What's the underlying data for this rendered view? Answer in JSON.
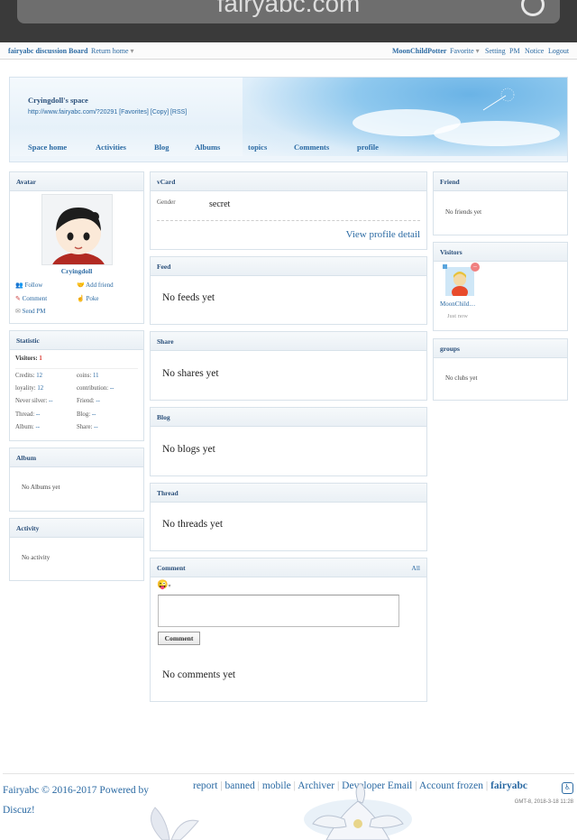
{
  "browser": {
    "url": "fairyabc.com"
  },
  "toolbar": {
    "site": "fairyabc discussion Board",
    "return_home": "Return home",
    "user": "MoonChildPotter",
    "favorite": "Favorite",
    "setting": "Setting",
    "pm": "PM",
    "notice": "Notice",
    "logout": "Logout"
  },
  "hero": {
    "title": "Cryingdoll's space",
    "url_line": "http://www.fairyabc.com/?20291 [Favorites] [Copy] [RSS]",
    "tabs": [
      "Space home",
      "Activities",
      "Blog",
      "Albums",
      "topics",
      "Comments",
      "profile"
    ]
  },
  "avatar": {
    "header": "Avatar",
    "name": "Cryingdoll",
    "actions": [
      "Follow",
      "Add friend",
      "Comment",
      "Poke",
      "Send PM"
    ]
  },
  "statistic": {
    "header": "Statistic",
    "visitors_label": "Visitors:",
    "visitors": "1",
    "rows": [
      [
        "Credits:",
        "12",
        "coins:",
        "11"
      ],
      [
        "loyality:",
        "12",
        "contribution:",
        "--"
      ],
      [
        "Never silver:",
        "--",
        "Friend:",
        "--"
      ],
      [
        "Thread:",
        "--",
        "Blog:",
        "--"
      ],
      [
        "Album:",
        "--",
        "Share:",
        "--"
      ]
    ]
  },
  "album": {
    "header": "Album",
    "empty": "No Albums yet"
  },
  "activity": {
    "header": "Activity",
    "empty": "No activity"
  },
  "vcard": {
    "header": "vCard",
    "gender_label": "Gender",
    "gender_value": "secret",
    "detail_link": "View profile detail"
  },
  "feed": {
    "header": "Feed",
    "empty": "No feeds yet"
  },
  "share": {
    "header": "Share",
    "empty": "No shares yet"
  },
  "blog": {
    "header": "Blog",
    "empty": "No blogs yet"
  },
  "thread": {
    "header": "Thread",
    "empty": "No threads yet"
  },
  "comment": {
    "header": "Comment",
    "all": "All",
    "button": "Comment",
    "empty": "No comments yet"
  },
  "friend": {
    "header": "Friend",
    "empty": "No friends yet"
  },
  "visitors": {
    "header": "Visitors",
    "name": "MoonChild…",
    "time": "Just now"
  },
  "groups": {
    "header": "groups",
    "empty": "No clubs yet"
  },
  "footer": {
    "copyright": "Fairyabc © 2016-2017 Powered by",
    "powered": "Discuz!",
    "links": [
      "report",
      "banned",
      "mobile",
      "Archiver",
      "Developer Email",
      "Account frozen"
    ],
    "brand": "fairyabc",
    "time": "GMT-8, 2018-3-18 11:28"
  },
  "colors": {
    "link": "#2b6aa3",
    "header_text": "#2a4f7a",
    "accent_red": "#d9342b"
  }
}
